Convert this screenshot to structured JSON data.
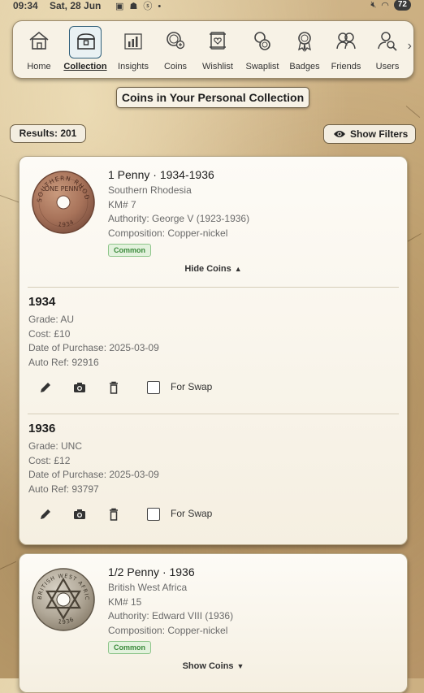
{
  "status_bar": {
    "time": "09:34",
    "date": "Sat, 28 Jun",
    "battery": "72"
  },
  "nav": {
    "items": [
      {
        "label": "Home",
        "icon": "home-icon"
      },
      {
        "label": "Collection",
        "icon": "treasure-chest-icon",
        "active": true
      },
      {
        "label": "Insights",
        "icon": "bar-chart-icon"
      },
      {
        "label": "Coins",
        "icon": "coins-search-icon"
      },
      {
        "label": "Wishlist",
        "icon": "wishlist-heart-icon"
      },
      {
        "label": "Swaplist",
        "icon": "swap-coins-icon"
      },
      {
        "label": "Badges",
        "icon": "badge-ribbon-icon"
      },
      {
        "label": "Friends",
        "icon": "friends-icon"
      },
      {
        "label": "Users",
        "icon": "user-search-icon"
      }
    ],
    "more_arrow": "›"
  },
  "page_title": "Coins in Your Personal Collection",
  "results_label": "Results: 201",
  "filters_button": "Show Filters",
  "cards": [
    {
      "title": "1 Penny · 1934-1936",
      "country": "Southern Rhodesia",
      "km": "KM# 7",
      "authority": "Authority: George V (1923-1936)",
      "composition": "Composition: Copper-nickel",
      "rarity": "Common",
      "toggle": "Hide Coins",
      "coin_legend": "SOUTHERN RHODESIA",
      "coin_center": "ONE PENNY",
      "coin_year": "1934",
      "entries": [
        {
          "year": "1934",
          "grade": "Grade: AU",
          "cost": "Cost: £10",
          "date": "Date of Purchase: 2025-03-09",
          "ref": "Auto Ref: 92916",
          "swap_label": "For Swap",
          "for_swap": false
        },
        {
          "year": "1936",
          "grade": "Grade: UNC",
          "cost": "Cost: £12",
          "date": "Date of Purchase: 2025-03-09",
          "ref": "Auto Ref: 93797",
          "swap_label": "For Swap",
          "for_swap": false
        }
      ]
    },
    {
      "title": "1/2 Penny · 1936",
      "country": "British West Africa",
      "km": "KM# 15",
      "authority": "Authority: Edward VIII (1936)",
      "composition": "Composition: Copper-nickel",
      "rarity": "Common",
      "toggle": "Show Coins",
      "coin_legend": "BRITISH WEST AFRICA",
      "coin_year": "1936"
    }
  ],
  "colors": {
    "active_frame": "#2f5f7a",
    "badge_text": "#3b8a3b",
    "badge_bg": "#e3f2dd",
    "card_bg": "#fdfbf6"
  }
}
